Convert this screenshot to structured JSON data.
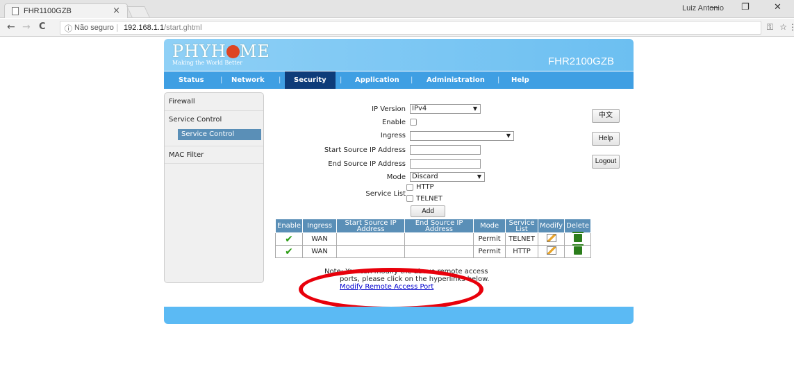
{
  "browser": {
    "tab_title": "FHR1100GZB",
    "tab_close": "×",
    "user_name": "Luiz Antonio",
    "win_minimize": "—",
    "win_restore": "❐",
    "win_close": "✕",
    "back": "←",
    "forward": "→",
    "reload": "C",
    "info_icon": "ⓘ",
    "security_text": "Não seguro",
    "url_host": "192.168.1.1",
    "url_path": "/start.ghtml",
    "key_icon": "⚿",
    "star_icon": "☆",
    "menu_icon": "⋮"
  },
  "banner": {
    "logo_text_pre": "PHYH",
    "logo_text_post": "ME",
    "slogan": "Making the World Better",
    "model": "FHR2100GZB"
  },
  "menu": {
    "status": "Status",
    "network": "Network",
    "security": "Security",
    "application": "Application",
    "administration": "Administration",
    "help": "Help",
    "sep": "|"
  },
  "sidebar": {
    "firewall": "Firewall",
    "service_control": "Service Control",
    "service_control_sub": "Service Control",
    "mac_filter": "MAC Filter"
  },
  "form": {
    "ip_version_label": "IP Version",
    "ip_version_value": "IPv4",
    "enable_label": "Enable",
    "ingress_label": "Ingress",
    "ingress_value": "",
    "start_ip_label": "Start Source IP Address",
    "end_ip_label": "End Source IP Address",
    "mode_label": "Mode",
    "mode_value": "Discard",
    "service_list_label": "Service List",
    "service_http": "HTTP",
    "service_telnet": "TELNET",
    "add_button": "Add",
    "dropdown_arrow": "▼"
  },
  "side_buttons": {
    "chinese": "中文",
    "help": "Help",
    "logout": "Logout"
  },
  "table": {
    "headers": [
      "Enable",
      "Ingress",
      "Start Source IP Address",
      "End Source IP Address",
      "Mode",
      "Service List",
      "Modify",
      "Delete"
    ],
    "rows": [
      {
        "enable": "✔",
        "ingress": "WAN",
        "start": "",
        "end": "",
        "mode": "Permit",
        "service": "TELNET"
      },
      {
        "enable": "✔",
        "ingress": "WAN",
        "start": "",
        "end": "",
        "mode": "Permit",
        "service": "HTTP"
      }
    ]
  },
  "note": {
    "line1": "Note: You can modify the above remote access",
    "line2": "ports, please click on the hyperlinks below.",
    "link": "Modify Remote Access Port"
  },
  "colors": {
    "menubar": "#3f9fe3",
    "active_menu": "#0e3c79",
    "annotation": "#e8000b"
  }
}
